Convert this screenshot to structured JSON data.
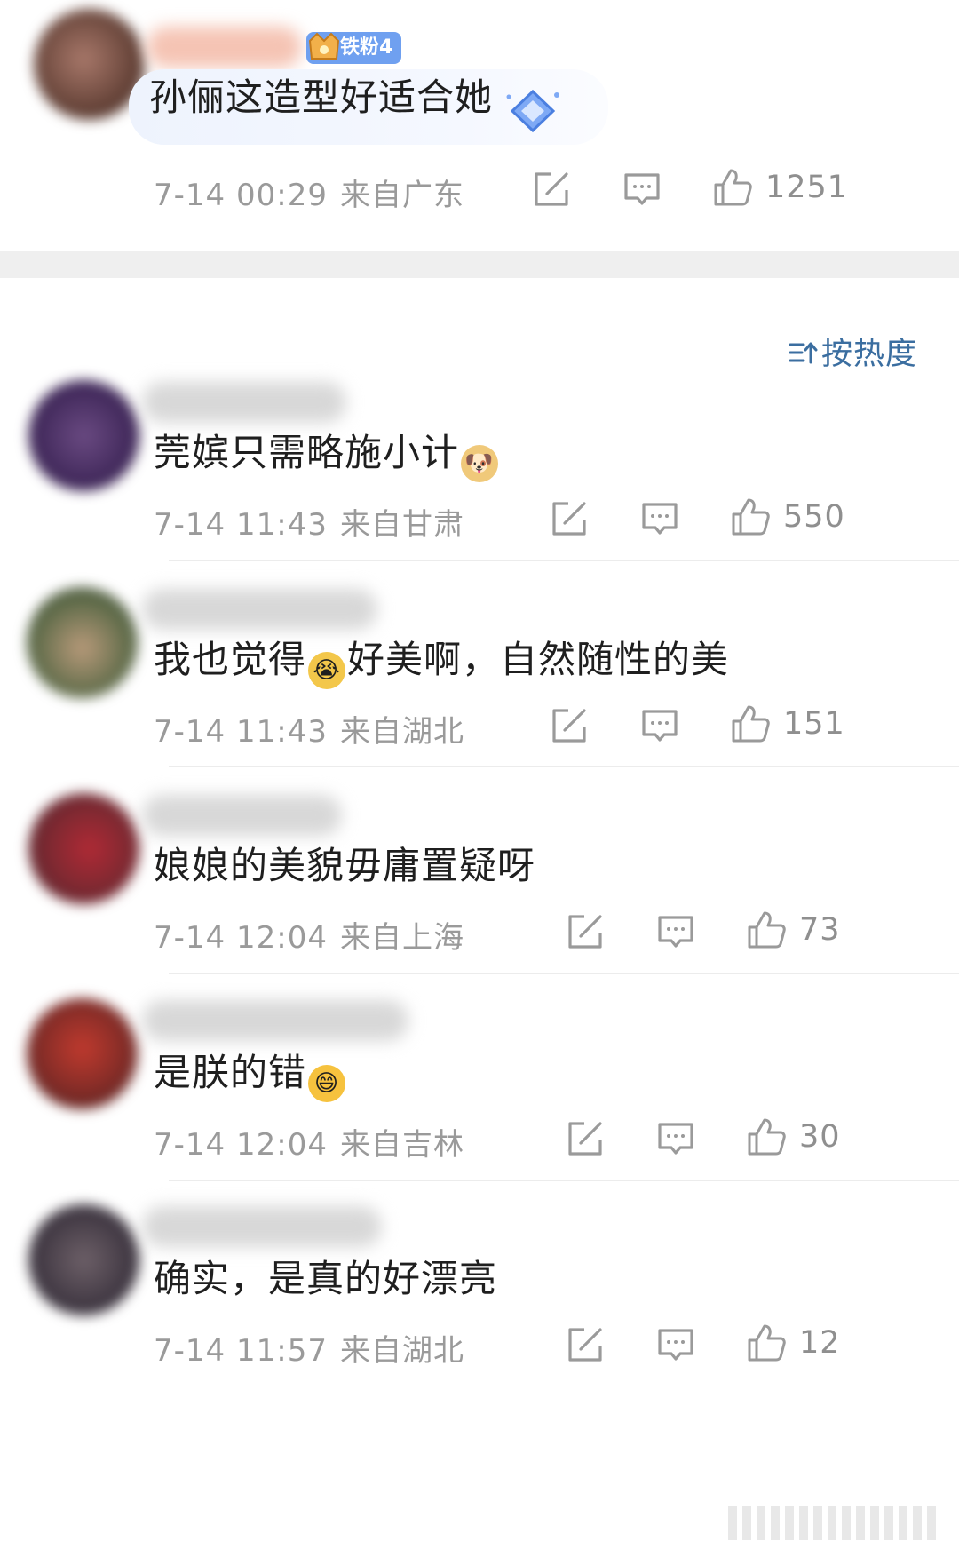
{
  "top_comment": {
    "badge_label": "铁粉4",
    "content": "孙俪这造型好适合她",
    "time": "7-14 00:29",
    "location": "来自广东",
    "likes": "1251"
  },
  "sort_label": "按热度",
  "comments": [
    {
      "content": "莞嫔只需略施小计",
      "emoji": "doge-emoji",
      "time": "7-14 11:43",
      "location": "来自甘肃",
      "likes": "550"
    },
    {
      "content_before": "我也觉得",
      "content_after": "好美啊，自然随性的美",
      "emoji": "crying-emoji",
      "time": "7-14 11:43",
      "location": "来自湖北",
      "likes": "151"
    },
    {
      "content": "娘娘的美貌毋庸置疑呀",
      "time": "7-14 12:04",
      "location": "来自上海",
      "likes": "73"
    },
    {
      "content": "是朕的错",
      "emoji": "laughing-emoji",
      "time": "7-14 12:04",
      "location": "来自吉林",
      "likes": "30"
    },
    {
      "content": "确实，是真的好漂亮",
      "time": "7-14 11:57",
      "location": "来自湖北",
      "likes": "12"
    }
  ],
  "colors": {
    "accent": "#3b6ea0",
    "meta_text": "#9a9a9a",
    "badge_bg": "#6fa0f0",
    "divider": "#ececec"
  }
}
